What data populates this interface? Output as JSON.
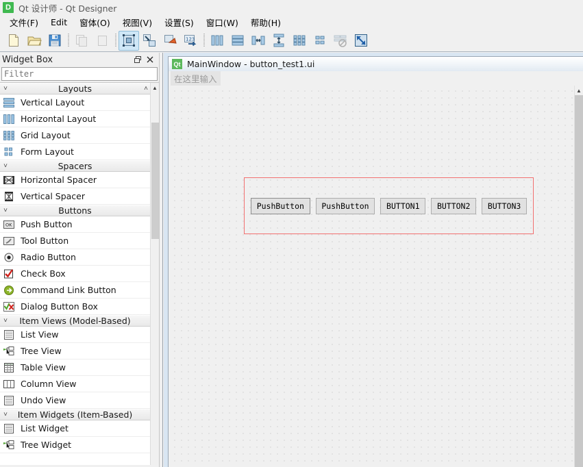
{
  "window": {
    "app_icon_letter": "D",
    "title": "Qt 设计师 - Qt Designer"
  },
  "menubar": {
    "items": [
      {
        "label": "文件(F)",
        "name": "menu-file"
      },
      {
        "label": "Edit",
        "name": "menu-edit"
      },
      {
        "label": "窗体(O)",
        "name": "menu-form"
      },
      {
        "label": "视图(V)",
        "name": "menu-view"
      },
      {
        "label": "设置(S)",
        "name": "menu-settings"
      },
      {
        "label": "窗口(W)",
        "name": "menu-window"
      },
      {
        "label": "帮助(H)",
        "name": "menu-help"
      }
    ]
  },
  "toolbar": {
    "buttons": [
      {
        "icon": "new-file-icon",
        "label": "New",
        "enabled": true,
        "active": false
      },
      {
        "icon": "open-folder-icon",
        "label": "Open",
        "enabled": true,
        "active": false
      },
      {
        "icon": "save-disk-icon",
        "label": "Save",
        "enabled": true,
        "active": false
      },
      {
        "icon": "separator",
        "label": "",
        "enabled": true,
        "active": false
      },
      {
        "icon": "copy-icon",
        "label": "Copy",
        "enabled": false,
        "active": false
      },
      {
        "icon": "paste-icon",
        "label": "Paste",
        "enabled": false,
        "active": false
      },
      {
        "icon": "separator",
        "label": "",
        "enabled": true,
        "active": false
      },
      {
        "icon": "edit-widgets-icon",
        "label": "Edit Widgets",
        "enabled": true,
        "active": true
      },
      {
        "icon": "edit-signals-slots-icon",
        "label": "Edit Signals/Slots",
        "enabled": true,
        "active": false
      },
      {
        "icon": "edit-buddies-icon",
        "label": "Edit Buddies",
        "enabled": true,
        "active": false
      },
      {
        "icon": "edit-tab-order-icon",
        "label": "Edit Tab Order",
        "enabled": true,
        "active": false
      },
      {
        "icon": "separator",
        "label": "",
        "enabled": true,
        "active": false
      },
      {
        "icon": "layout-horizontal-icon",
        "label": "Lay Out Horizontally",
        "enabled": true,
        "active": false
      },
      {
        "icon": "layout-vertical-icon",
        "label": "Lay Out Vertically",
        "enabled": true,
        "active": false
      },
      {
        "icon": "layout-splitter-h-icon",
        "label": "Lay Out Horizontally in Splitter",
        "enabled": true,
        "active": false
      },
      {
        "icon": "layout-splitter-v-icon",
        "label": "Lay Out Vertically in Splitter",
        "enabled": true,
        "active": false
      },
      {
        "icon": "layout-grid-icon",
        "label": "Lay Out in a Grid",
        "enabled": true,
        "active": false
      },
      {
        "icon": "layout-form-icon",
        "label": "Lay Out in a Form Layout",
        "enabled": true,
        "active": false
      },
      {
        "icon": "break-layout-icon",
        "label": "Break Layout",
        "enabled": false,
        "active": false
      },
      {
        "icon": "adjust-size-icon",
        "label": "Adjust Size",
        "enabled": true,
        "active": false
      }
    ]
  },
  "widget_box": {
    "title": "Widget Box",
    "float_button": "float-icon",
    "close_button": "close-icon",
    "filter": {
      "value": "",
      "placeholder": "Filter"
    },
    "groups": [
      {
        "name": "Layouts",
        "expanded": true,
        "items": [
          {
            "label": "Vertical Layout",
            "icon": "vertical-layout-icon"
          },
          {
            "label": "Horizontal Layout",
            "icon": "horizontal-layout-icon"
          },
          {
            "label": "Grid Layout",
            "icon": "grid-layout-icon"
          },
          {
            "label": "Form Layout",
            "icon": "form-layout-icon"
          }
        ]
      },
      {
        "name": "Spacers",
        "expanded": true,
        "items": [
          {
            "label": "Horizontal Spacer",
            "icon": "horizontal-spacer-icon"
          },
          {
            "label": "Vertical Spacer",
            "icon": "vertical-spacer-icon"
          }
        ]
      },
      {
        "name": "Buttons",
        "expanded": true,
        "items": [
          {
            "label": "Push Button",
            "icon": "push-button-icon"
          },
          {
            "label": "Tool Button",
            "icon": "tool-button-icon"
          },
          {
            "label": "Radio Button",
            "icon": "radio-button-icon"
          },
          {
            "label": "Check Box",
            "icon": "check-box-icon"
          },
          {
            "label": "Command Link Button",
            "icon": "command-link-button-icon"
          },
          {
            "label": "Dialog Button Box",
            "icon": "dialog-button-box-icon"
          }
        ]
      },
      {
        "name": "Item Views (Model-Based)",
        "expanded": true,
        "items": [
          {
            "label": "List View",
            "icon": "list-view-icon"
          },
          {
            "label": "Tree View",
            "icon": "tree-view-icon"
          },
          {
            "label": "Table View",
            "icon": "table-view-icon"
          },
          {
            "label": "Column View",
            "icon": "column-view-icon"
          },
          {
            "label": "Undo View",
            "icon": "undo-view-icon"
          }
        ]
      },
      {
        "name": "Item Widgets (Item-Based)",
        "expanded": true,
        "items": [
          {
            "label": "List Widget",
            "icon": "list-widget-icon"
          },
          {
            "label": "Tree Widget",
            "icon": "tree-widget-icon"
          }
        ]
      }
    ]
  },
  "form_window": {
    "icon_letter": "Qt",
    "title": "MainWindow - button_test1.ui",
    "menu_placeholder": "在这里输入",
    "selection": {
      "color": "#f26f6f",
      "buttons": [
        {
          "text": "PushButton",
          "selected": true
        },
        {
          "text": "PushButton",
          "selected": false
        },
        {
          "text": "BUTTON1",
          "selected": false
        },
        {
          "text": "BUTTON2",
          "selected": false
        },
        {
          "text": "BUTTON3",
          "selected": false
        }
      ]
    }
  },
  "colors": {
    "accent": "#cfe7f7",
    "mdi_background": "#d9e6f2",
    "selection_red": "#f26f6f",
    "button_face": "#e1e1e1"
  }
}
